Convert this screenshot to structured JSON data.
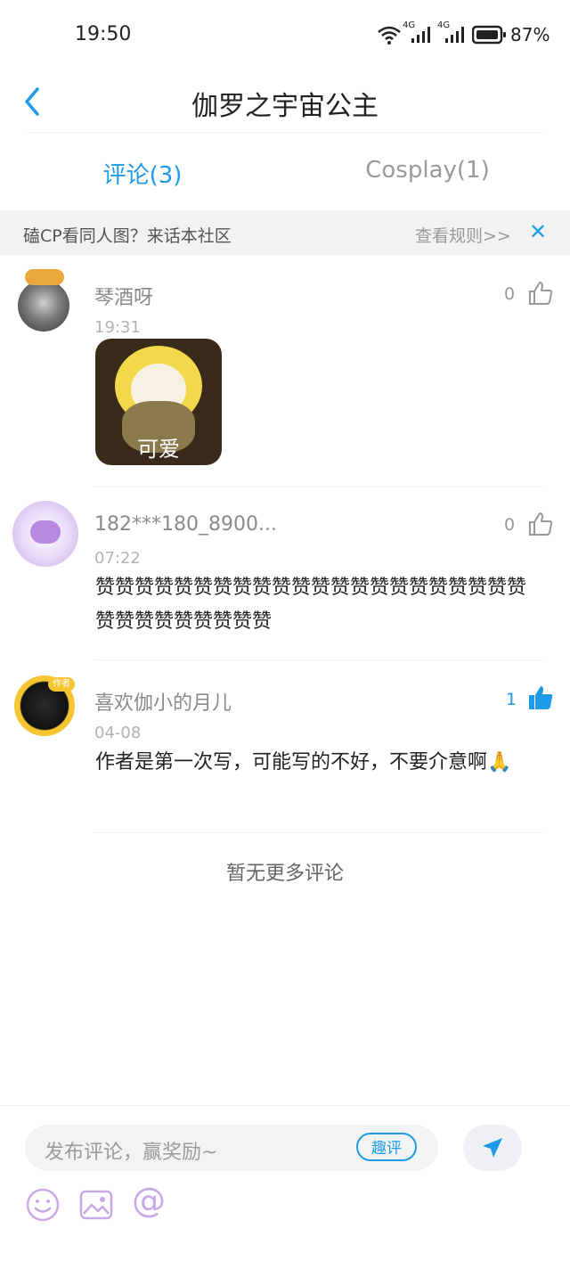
{
  "status_bar": {
    "time": "19:50",
    "battery_pct": "87%",
    "network_a": "4G",
    "network_b": "4G"
  },
  "header": {
    "title": "伽罗之宇宙公主",
    "back_icon": "chevron-left-icon"
  },
  "tabs": [
    {
      "label": "评论(3)",
      "active": true
    },
    {
      "label": "Cosplay(1)",
      "active": false
    }
  ],
  "banner": {
    "text": "磕CP看同人图？来话本社区",
    "rules": "查看规则>>",
    "close": "✕"
  },
  "comments": [
    {
      "user": "琴酒呀",
      "time": "19:31",
      "likes": "0",
      "liked": false,
      "text": "",
      "image_caption": "可爱"
    },
    {
      "user": "182***180_8900...",
      "time": "07:22",
      "likes": "0",
      "liked": false,
      "text": "赞赞赞赞赞赞赞赞赞赞赞赞赞赞赞赞赞赞赞赞赞赞赞赞赞赞赞赞赞赞赞"
    },
    {
      "user": "喜欢伽小的月儿",
      "time": "04-08",
      "likes": "1",
      "liked": true,
      "text": "作者是第一次写，可能写的不好，不要介意啊🙏",
      "badge": "作者"
    }
  ],
  "footer_note": "暂无更多评论",
  "composer": {
    "placeholder": "发布评论，赢奖励~",
    "quick_review": "趣评",
    "send_icon": "send-icon",
    "icons": [
      "emoji-icon",
      "image-icon",
      "at-icon"
    ],
    "at_symbol": "@"
  },
  "colors": {
    "accent": "#1e9be6",
    "muted": "#9a9a9a",
    "banner_bg": "#f2f2f2",
    "icon_purple": "#c9a8e6"
  }
}
